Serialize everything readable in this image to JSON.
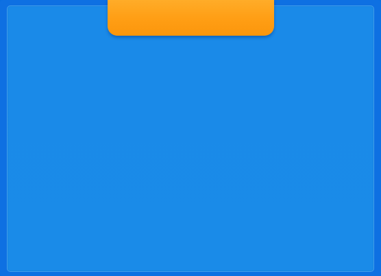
{
  "header_tab": {
    "label": ""
  },
  "colors": {
    "background": "#0e70e2",
    "panel": "#1a8be8",
    "tab": "#ff9e14"
  }
}
